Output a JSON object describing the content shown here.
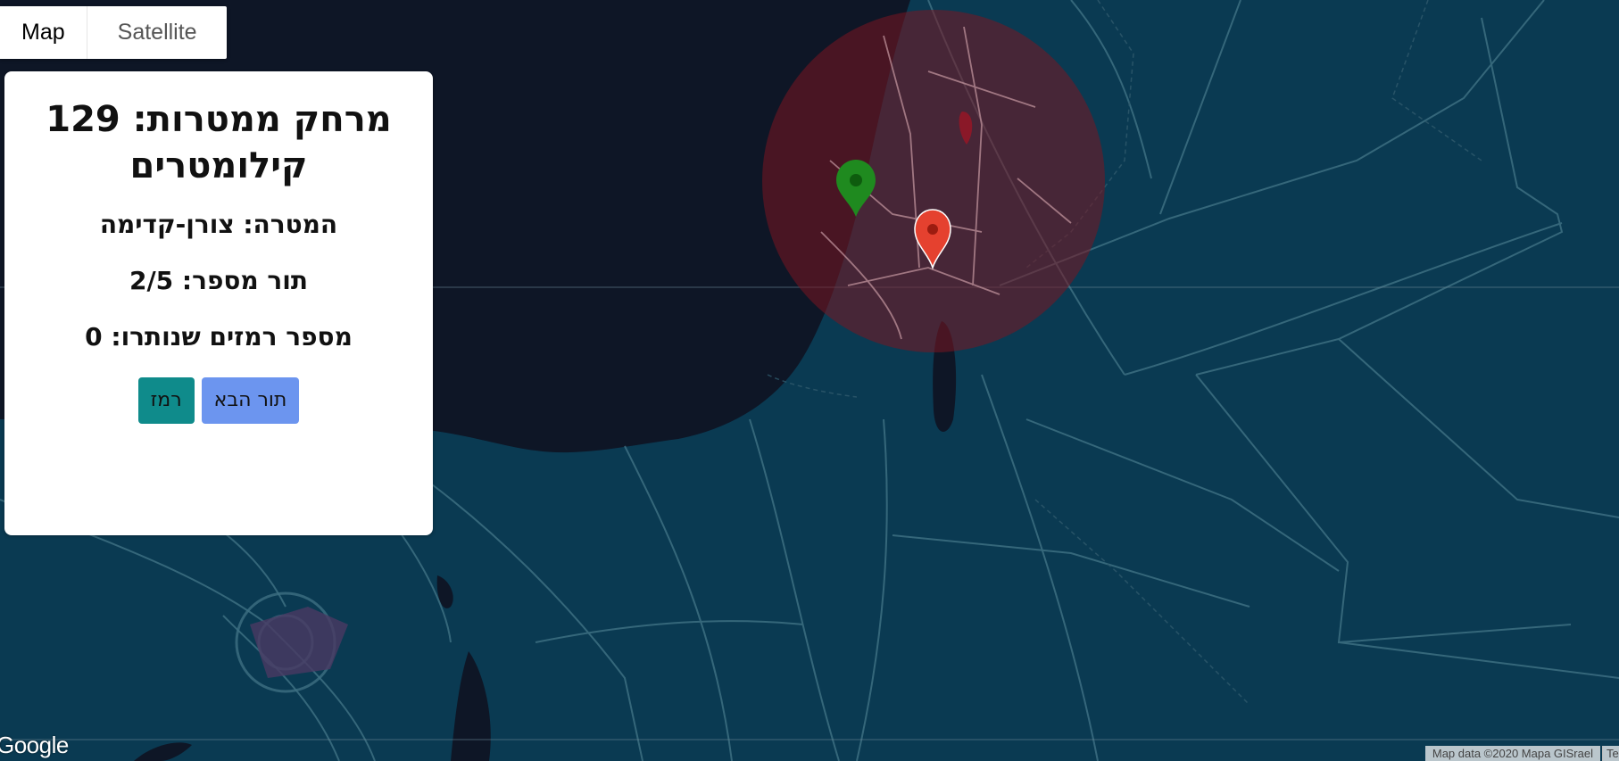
{
  "map": {
    "type_control": {
      "map_label": "Map",
      "satellite_label": "Satellite",
      "selected": "Map"
    },
    "theme": "dark",
    "colors": {
      "land": "#0a3a52",
      "sea": "#0e1626",
      "roads": "#3d6f82",
      "target_circle": "#7a1520",
      "guess_marker": "#1f8a1f",
      "target_marker": "#e5412f"
    },
    "markers": [
      {
        "name": "guess",
        "color": "green",
        "icon": "map-pin-icon"
      },
      {
        "name": "target",
        "color": "red",
        "icon": "map-pin-icon"
      }
    ],
    "google_logo": "Google",
    "attribution": "Map data ©2020 Mapa GISrael",
    "terms": "Terms"
  },
  "panel": {
    "distance_title": "מרחק ממטרות: 129 קילומטרים",
    "target_line": "המטרה: צורן-קדימה",
    "round_line": "תור מספר: 2/5",
    "hints_line": "מספר רמזים שנותרו: 0",
    "hint_button": "רמז",
    "next_button": "תור הבא"
  }
}
